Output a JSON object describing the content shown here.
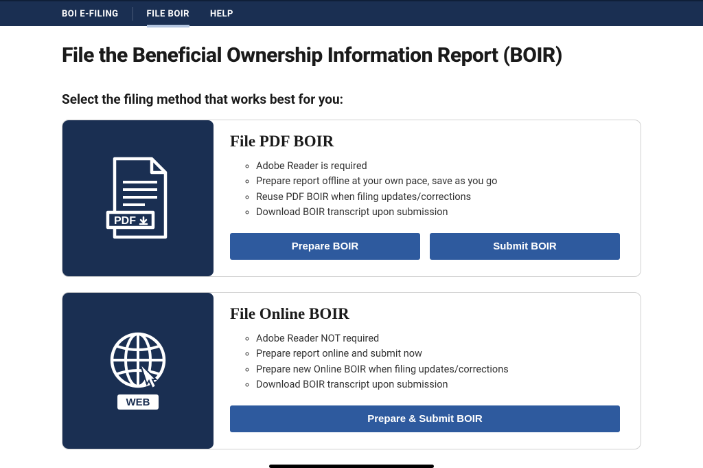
{
  "topbar": {
    "brand": "BOI E-FILING",
    "nav": [
      "FILE BOIR",
      "HELP"
    ],
    "active_index": 0
  },
  "page": {
    "title": "File the Beneficial Ownership Information Report (BOIR)",
    "subtitle": "Select the filing method that works best for you:"
  },
  "colors": {
    "nav_bg": "#1a2f52",
    "button_bg": "#2e5a9e"
  },
  "cards": [
    {
      "title": "File PDF BOIR",
      "bullets": [
        "Adobe Reader is required",
        "Prepare report offline at your own pace, save as you go",
        "Reuse PDF BOIR when filing updates/corrections",
        "Download BOIR transcript upon submission"
      ],
      "buttons": [
        "Prepare BOIR",
        "Submit BOIR"
      ]
    },
    {
      "title": "File Online BOIR",
      "bullets": [
        "Adobe Reader NOT required",
        "Prepare report online and submit now",
        "Prepare new Online BOIR when filing updates/corrections",
        "Download BOIR transcript upon submission"
      ],
      "buttons": [
        "Prepare & Submit BOIR"
      ]
    }
  ]
}
